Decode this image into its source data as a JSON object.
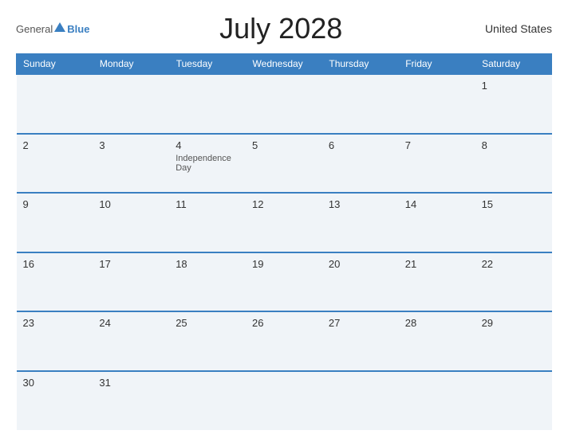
{
  "header": {
    "logo_general": "General",
    "logo_blue": "Blue",
    "title": "July 2028",
    "country": "United States"
  },
  "weekdays": [
    "Sunday",
    "Monday",
    "Tuesday",
    "Wednesday",
    "Thursday",
    "Friday",
    "Saturday"
  ],
  "weeks": [
    [
      {
        "day": "",
        "empty": true
      },
      {
        "day": "",
        "empty": true
      },
      {
        "day": "",
        "empty": true
      },
      {
        "day": "",
        "empty": true
      },
      {
        "day": "",
        "empty": true
      },
      {
        "day": "",
        "empty": true
      },
      {
        "day": "1",
        "event": ""
      }
    ],
    [
      {
        "day": "2",
        "event": ""
      },
      {
        "day": "3",
        "event": ""
      },
      {
        "day": "4",
        "event": "Independence Day"
      },
      {
        "day": "5",
        "event": ""
      },
      {
        "day": "6",
        "event": ""
      },
      {
        "day": "7",
        "event": ""
      },
      {
        "day": "8",
        "event": ""
      }
    ],
    [
      {
        "day": "9",
        "event": ""
      },
      {
        "day": "10",
        "event": ""
      },
      {
        "day": "11",
        "event": ""
      },
      {
        "day": "12",
        "event": ""
      },
      {
        "day": "13",
        "event": ""
      },
      {
        "day": "14",
        "event": ""
      },
      {
        "day": "15",
        "event": ""
      }
    ],
    [
      {
        "day": "16",
        "event": ""
      },
      {
        "day": "17",
        "event": ""
      },
      {
        "day": "18",
        "event": ""
      },
      {
        "day": "19",
        "event": ""
      },
      {
        "day": "20",
        "event": ""
      },
      {
        "day": "21",
        "event": ""
      },
      {
        "day": "22",
        "event": ""
      }
    ],
    [
      {
        "day": "23",
        "event": ""
      },
      {
        "day": "24",
        "event": ""
      },
      {
        "day": "25",
        "event": ""
      },
      {
        "day": "26",
        "event": ""
      },
      {
        "day": "27",
        "event": ""
      },
      {
        "day": "28",
        "event": ""
      },
      {
        "day": "29",
        "event": ""
      }
    ],
    [
      {
        "day": "30",
        "event": ""
      },
      {
        "day": "31",
        "event": ""
      },
      {
        "day": "",
        "empty": true
      },
      {
        "day": "",
        "empty": true
      },
      {
        "day": "",
        "empty": true
      },
      {
        "day": "",
        "empty": true
      },
      {
        "day": "",
        "empty": true
      }
    ]
  ]
}
